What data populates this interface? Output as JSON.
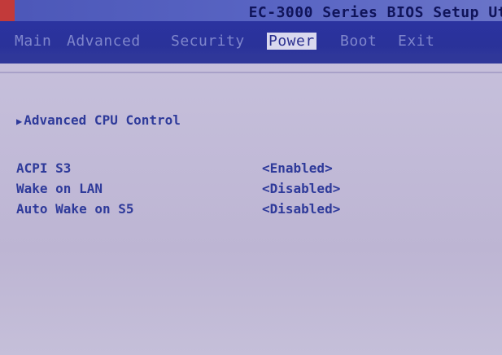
{
  "title": "EC-3000 Series BIOS Setup Ut",
  "menu": {
    "main": "Main",
    "advanced": "Advanced",
    "security": "Security",
    "power": "Power",
    "boot": "Boot",
    "exit": "Exit",
    "active": "power"
  },
  "content": {
    "submenu_label": "Advanced CPU Control",
    "submenu_arrow": "▶",
    "settings": [
      {
        "label": "ACPI S3",
        "value": "<Enabled>"
      },
      {
        "label": "Wake on LAN",
        "value": "<Disabled>"
      },
      {
        "label": "Auto Wake on S5",
        "value": "<Disabled>"
      }
    ]
  },
  "colors": {
    "title_bar": "#4c57b8",
    "menu_bar": "#2b33a0",
    "active_tab_bg": "#d9d8ee",
    "body_bg": "#c2bbd8",
    "text": "#2e3a9a"
  }
}
